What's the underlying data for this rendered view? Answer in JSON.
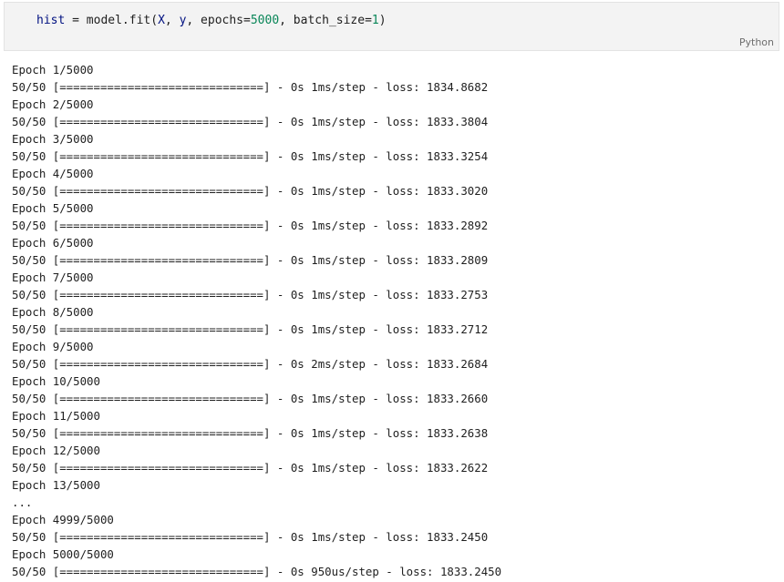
{
  "cell": {
    "code": {
      "assign_target": "hist",
      "equals": " = ",
      "call": "model.fit(",
      "arg_x": "X",
      "sep1": ", ",
      "arg_y": "y",
      "sep2": ", epochs=",
      "epochs": "5000",
      "sep3": ", batch_size=",
      "batch_size": "1",
      "close": ")"
    },
    "language": "Python"
  },
  "output_lines": [
    "Epoch 1/5000",
    "50/50 [==============================] - 0s 1ms/step - loss: 1834.8682",
    "Epoch 2/5000",
    "50/50 [==============================] - 0s 1ms/step - loss: 1833.3804",
    "Epoch 3/5000",
    "50/50 [==============================] - 0s 1ms/step - loss: 1833.3254",
    "Epoch 4/5000",
    "50/50 [==============================] - 0s 1ms/step - loss: 1833.3020",
    "Epoch 5/5000",
    "50/50 [==============================] - 0s 1ms/step - loss: 1833.2892",
    "Epoch 6/5000",
    "50/50 [==============================] - 0s 1ms/step - loss: 1833.2809",
    "Epoch 7/5000",
    "50/50 [==============================] - 0s 1ms/step - loss: 1833.2753",
    "Epoch 8/5000",
    "50/50 [==============================] - 0s 1ms/step - loss: 1833.2712",
    "Epoch 9/5000",
    "50/50 [==============================] - 0s 2ms/step - loss: 1833.2684",
    "Epoch 10/5000",
    "50/50 [==============================] - 0s 1ms/step - loss: 1833.2660",
    "Epoch 11/5000",
    "50/50 [==============================] - 0s 1ms/step - loss: 1833.2638",
    "Epoch 12/5000",
    "50/50 [==============================] - 0s 1ms/step - loss: 1833.2622",
    "Epoch 13/5000",
    "...",
    "Epoch 4999/5000",
    "50/50 [==============================] - 0s 1ms/step - loss: 1833.2450",
    "Epoch 5000/5000",
    "50/50 [==============================] - 0s 950us/step - loss: 1833.2450"
  ]
}
